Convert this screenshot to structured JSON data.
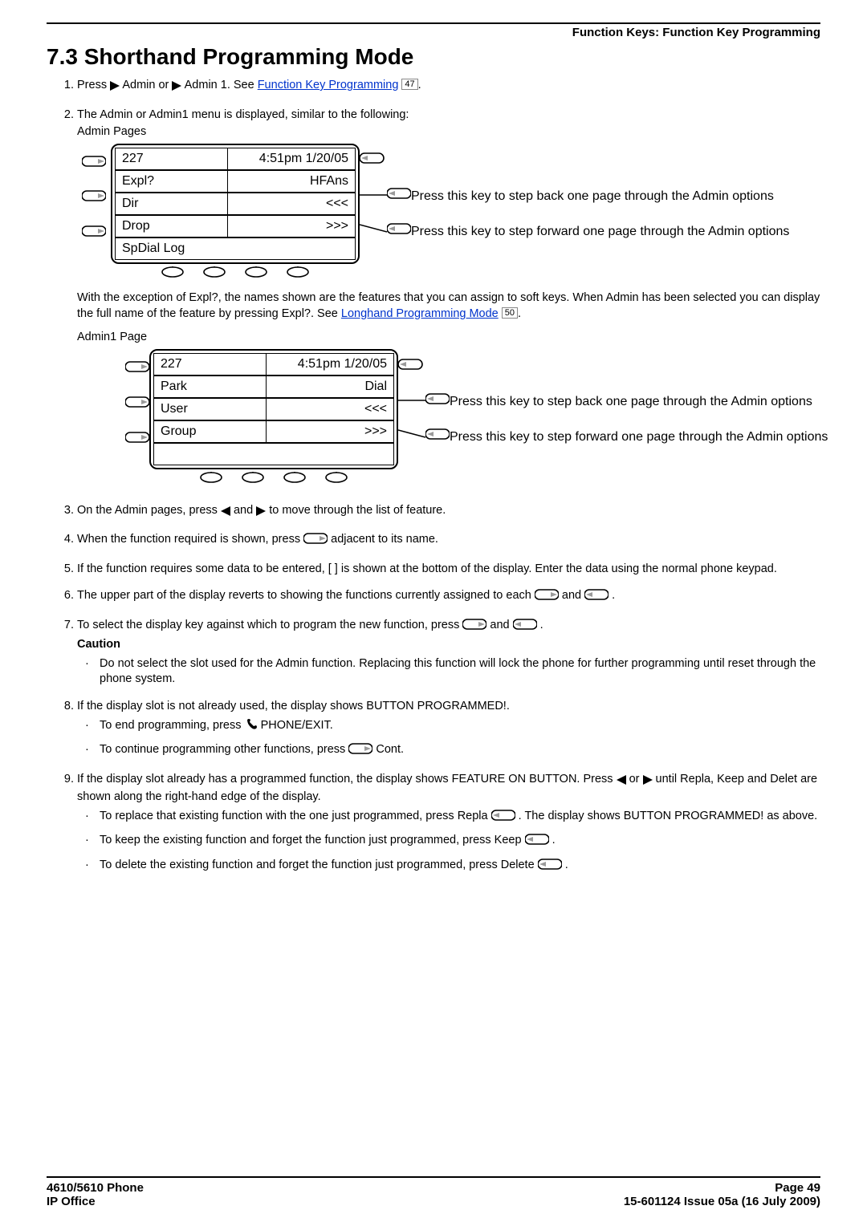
{
  "header": {
    "breadcrumb": "Function Keys: Function Key Programming"
  },
  "title": "7.3 Shorthand Programming Mode",
  "step1": {
    "pre": "Press ",
    "admin": " Admin or ",
    "admin1": " Admin 1. See ",
    "link": "Function Key Programming",
    "ref": "47",
    "post": "."
  },
  "step2": {
    "text": "The Admin or Admin1 menu is displayed, similar to the following:",
    "label": "Admin Pages"
  },
  "fig1": {
    "r1l": "227",
    "r1r": "4:51pm 1/20/05",
    "r2l": "Expl?",
    "r2r": "HFAns",
    "r3l": "Dir",
    "r3r": "<<<",
    "r4l": "Drop",
    "r4r": ">>>",
    "r5": "SpDial  Log",
    "ann_back": "Press this key to step back one page through the Admin options",
    "ann_fwd": "Press this key to step forward one page through the Admin options"
  },
  "afterFig1": {
    "pre": "With the exception of Expl?, the names shown are the features that you can assign to soft keys. When Admin has been selected you can display the full name of the feature by pressing Expl?. See ",
    "link": "Longhand Programming Mode",
    "ref": "50",
    "post": "."
  },
  "admin1Label": "Admin1 Page",
  "fig2": {
    "r1l": "227",
    "r1r": "4:51pm 1/20/05",
    "r2l": "Park",
    "r2r": "Dial",
    "r3l": "User",
    "r3r": "<<<",
    "r4l": "Group",
    "r4r": ">>>",
    "ann_back": "Press this key to step back one page through the Admin options",
    "ann_fwd": "Press this key to step forward one page through the Admin options"
  },
  "step3": {
    "pre": "On the Admin pages, press ",
    "mid": " and ",
    "post": " to move through the list of feature."
  },
  "step4": {
    "pre": "When the function required is shown, press ",
    "post": " adjacent to its name."
  },
  "step5": "If the function requires some data to be entered, [ ] is shown at the bottom of the display. Enter the data using the normal phone keypad.",
  "step6": {
    "pre": "The upper part of the display reverts to showing the functions currently assigned to each ",
    "mid": " and ",
    "post": "."
  },
  "step7": {
    "pre": "To select the display key against which to program the new function, press ",
    "mid": " and ",
    "post": ".",
    "caution": "Caution",
    "bullet": "Do not select the slot used for the Admin function. Replacing this function will lock the phone for further programming until reset through the phone system."
  },
  "step8": {
    "text": "If the display slot is not already used, the display shows BUTTON PROGRAMMED!.",
    "b1pre": "To end programming, press ",
    "b1post": " PHONE/EXIT.",
    "b2pre": "To continue programming other functions, press ",
    "b2post": " Cont."
  },
  "step9": {
    "pre": "If the display slot already has a programmed function, the display shows FEATURE ON BUTTON. Press ",
    "mid": " or ",
    "post": " until Repla, Keep and Delet are shown along the right-hand edge of the display.",
    "b1pre": "To replace that existing function with the one just programmed, press Repla ",
    "b1post": ". The display shows BUTTON PROGRAMMED! as above.",
    "b2pre": "To keep the existing function and forget the function just programmed, press Keep ",
    "b2post": ".",
    "b3pre": "To delete the existing function and forget the function just programmed, press Delete ",
    "b3post": "."
  },
  "footer": {
    "left1": "4610/5610 Phone",
    "left2": "IP Office",
    "right1": "Page 49",
    "right2": "15-601124 Issue 05a (16 July 2009)"
  }
}
